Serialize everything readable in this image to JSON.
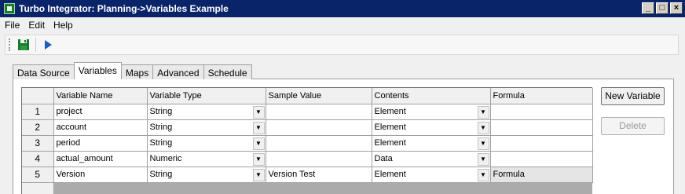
{
  "window": {
    "title": "Turbo Integrator:  Planning->Variables Example",
    "minimize_glyph": "_",
    "maximize_glyph": "□",
    "close_glyph": "×"
  },
  "menu": {
    "items": [
      {
        "label": "File"
      },
      {
        "label": "Edit"
      },
      {
        "label": "Help"
      }
    ]
  },
  "toolbar": {
    "icons": [
      "save-icon",
      "run-icon"
    ]
  },
  "tabs": [
    {
      "label": "Data Source",
      "active": false
    },
    {
      "label": "Variables",
      "active": true
    },
    {
      "label": "Maps",
      "active": false
    },
    {
      "label": "Advanced",
      "active": false
    },
    {
      "label": "Schedule",
      "active": false
    }
  ],
  "grid": {
    "columns": [
      "Variable Name",
      "Variable Type",
      "Sample Value",
      "Contents",
      "Formula"
    ],
    "rows": [
      {
        "num": "1",
        "name": "project",
        "type": "String",
        "sample": "",
        "contents": "Element",
        "formula": ""
      },
      {
        "num": "2",
        "name": "account",
        "type": "String",
        "sample": "",
        "contents": "Element",
        "formula": ""
      },
      {
        "num": "3",
        "name": "period",
        "type": "String",
        "sample": "",
        "contents": "Element",
        "formula": ""
      },
      {
        "num": "4",
        "name": "actual_amount",
        "type": "Numeric",
        "sample": "",
        "contents": "Data",
        "formula": ""
      },
      {
        "num": "5",
        "name": "Version",
        "type": "String",
        "sample": "Version Test",
        "contents": "Element",
        "formula": "Formula"
      }
    ]
  },
  "buttons": {
    "new_variable": "New Variable",
    "delete": "Delete"
  },
  "colors": {
    "titlebar": "#0a246a",
    "save_icon": "#1c7a2e",
    "run_icon": "#1f5fbf"
  }
}
